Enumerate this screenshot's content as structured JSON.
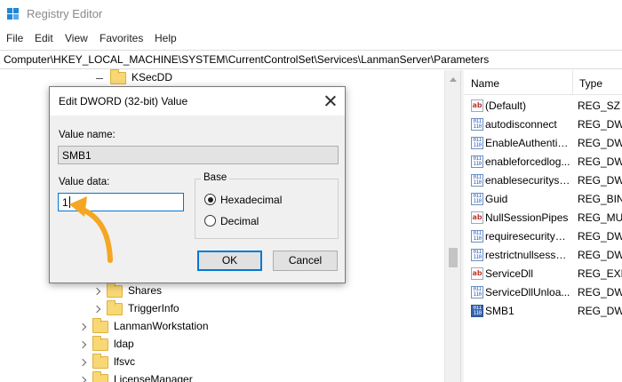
{
  "window": {
    "title": "Registry Editor",
    "app_icon": "registry-editor-icon"
  },
  "menu": [
    "File",
    "Edit",
    "View",
    "Favorites",
    "Help"
  ],
  "address": "Computer\\HKEY_LOCAL_MACHINE\\SYSTEM\\CurrentControlSet\\Services\\LanmanServer\\Parameters",
  "tree": {
    "top_item": "KSecDD",
    "items": [
      {
        "label": "Shares"
      },
      {
        "label": "TriggerInfo"
      },
      {
        "label": "LanmanWorkstation"
      },
      {
        "label": "ldap"
      },
      {
        "label": "lfsvc"
      },
      {
        "label": "LicenseManager"
      }
    ]
  },
  "list": {
    "columns": {
      "name": "Name",
      "type": "Type"
    },
    "rows": [
      {
        "name": "(Default)",
        "type": "REG_SZ",
        "icon": "string-value-icon"
      },
      {
        "name": "autodisconnect",
        "type": "REG_DWC",
        "icon": "binary-value-icon"
      },
      {
        "name": "EnableAuthentic...",
        "type": "REG_DWC",
        "icon": "binary-value-icon"
      },
      {
        "name": "enableforcedlog...",
        "type": "REG_DWC",
        "icon": "binary-value-icon"
      },
      {
        "name": "enablesecuritysi...",
        "type": "REG_DWC",
        "icon": "binary-value-icon"
      },
      {
        "name": "Guid",
        "type": "REG_BINA",
        "icon": "binary-value-icon"
      },
      {
        "name": "NullSessionPipes",
        "type": "REG_MUL",
        "icon": "string-value-icon"
      },
      {
        "name": "requiresecuritysi...",
        "type": "REG_DWC",
        "icon": "binary-value-icon"
      },
      {
        "name": "restrictnullsessa...",
        "type": "REG_DWC",
        "icon": "binary-value-icon"
      },
      {
        "name": "ServiceDll",
        "type": "REG_EXPA",
        "icon": "string-value-icon"
      },
      {
        "name": "ServiceDllUnloa...",
        "type": "REG_DWC",
        "icon": "binary-value-icon"
      },
      {
        "name": "SMB1",
        "type": "REG_DWC",
        "icon": "binary-value-icon",
        "selected": true
      }
    ]
  },
  "dialog": {
    "title": "Edit DWORD (32-bit) Value",
    "value_name_label": "Value name:",
    "value_name": "SMB1",
    "value_data_label": "Value data:",
    "value_data": "1",
    "base_label": "Base",
    "radio_hex": "Hexadecimal",
    "radio_dec": "Decimal",
    "base_selected": "Hexadecimal",
    "ok": "OK",
    "cancel": "Cancel"
  },
  "colors": {
    "accent": "#0078d7",
    "annotation_arrow": "#f5a623",
    "folder": "#f8d775"
  }
}
